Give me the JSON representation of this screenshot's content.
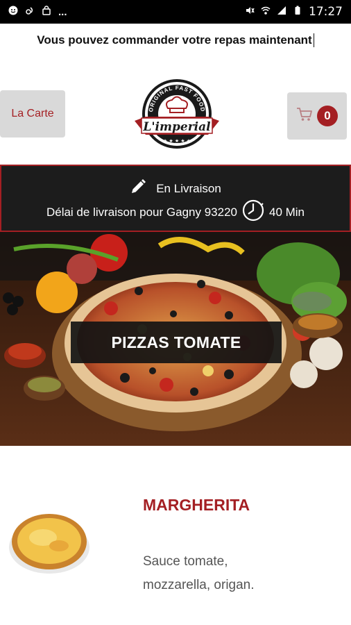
{
  "status_bar": {
    "time": "17:27",
    "notif_dots": "...",
    "icons": [
      "smiley-icon",
      "radio-icon",
      "shopping-bag-icon",
      "mute-icon",
      "wifi-icon",
      "signal-icon",
      "battery-icon"
    ]
  },
  "marquee": {
    "text": "Vous pouvez commander votre repas maintenant"
  },
  "header": {
    "menu_button_label": "La Carte",
    "logo": {
      "top_text": "ORIGINAL FAST FOOD",
      "brand": "L'imperial"
    },
    "cart_count": "0"
  },
  "delivery": {
    "mode_label": "En Livraison",
    "delay_label": "Délai de livraison pour Gagny 93220",
    "delay_time": "40 Min"
  },
  "category": {
    "title": "PIZZAS TOMATE"
  },
  "product": {
    "name": "MARGHERITA",
    "description": "Sauce tomate, mozzarella, origan."
  },
  "colors": {
    "accent": "#a41f23",
    "banner_bg": "#1c1c1c",
    "button_bg": "#d9d9d9"
  }
}
